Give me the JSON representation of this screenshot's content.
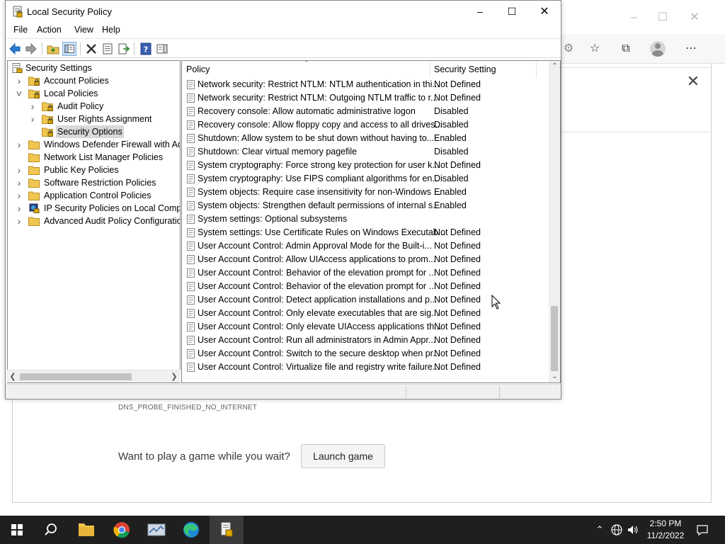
{
  "edge": {
    "error_code": "DNS_PROBE_FINISHED_NO_INTERNET",
    "game_prompt": "Want to play a game while you wait?",
    "launch_game_label": "Launch game"
  },
  "window": {
    "title": "Local Security Policy",
    "menu": [
      "File",
      "Action",
      "View",
      "Help"
    ]
  },
  "tree": {
    "items": [
      {
        "label": "Security Settings",
        "level": 0,
        "toggle": "",
        "icon": "security-settings-icon"
      },
      {
        "label": "Account Policies",
        "level": 1,
        "toggle": ">",
        "icon": "folder-lock-icon"
      },
      {
        "label": "Local Policies",
        "level": 1,
        "toggle": "v",
        "icon": "folder-lock-icon"
      },
      {
        "label": "Audit Policy",
        "level": 2,
        "toggle": ">",
        "icon": "folder-lock-icon"
      },
      {
        "label": "User Rights Assignment",
        "level": 2,
        "toggle": ">",
        "icon": "folder-lock-icon"
      },
      {
        "label": "Security Options",
        "level": 2,
        "toggle": "",
        "icon": "folder-lock-icon",
        "selected": true
      },
      {
        "label": "Windows Defender Firewall with Adva",
        "level": 1,
        "toggle": ">",
        "icon": "folder-icon"
      },
      {
        "label": "Network List Manager Policies",
        "level": 1,
        "toggle": "",
        "icon": "folder-icon"
      },
      {
        "label": "Public Key Policies",
        "level": 1,
        "toggle": ">",
        "icon": "folder-icon"
      },
      {
        "label": "Software Restriction Policies",
        "level": 1,
        "toggle": ">",
        "icon": "folder-icon"
      },
      {
        "label": "Application Control Policies",
        "level": 1,
        "toggle": ">",
        "icon": "folder-icon"
      },
      {
        "label": "IP Security Policies on Local Compute",
        "level": 1,
        "toggle": ">",
        "icon": "ip-security-icon"
      },
      {
        "label": "Advanced Audit Policy Configuration",
        "level": 1,
        "toggle": ">",
        "icon": "folder-icon"
      }
    ]
  },
  "list": {
    "col_policy": "Policy",
    "col_setting": "Security Setting",
    "rows": [
      {
        "policy": "Network security: Restrict NTLM: NTLM authentication in thi...",
        "setting": "Not Defined"
      },
      {
        "policy": "Network security: Restrict NTLM: Outgoing NTLM traffic to r...",
        "setting": "Not Defined"
      },
      {
        "policy": "Recovery console: Allow automatic administrative logon",
        "setting": "Disabled"
      },
      {
        "policy": "Recovery console: Allow floppy copy and access to all drives...",
        "setting": "Disabled"
      },
      {
        "policy": "Shutdown: Allow system to be shut down without having to...",
        "setting": "Enabled"
      },
      {
        "policy": "Shutdown: Clear virtual memory pagefile",
        "setting": "Disabled"
      },
      {
        "policy": "System cryptography: Force strong key protection for user k...",
        "setting": "Not Defined"
      },
      {
        "policy": "System cryptography: Use FIPS compliant algorithms for en...",
        "setting": "Disabled"
      },
      {
        "policy": "System objects: Require case insensitivity for non-Windows ...",
        "setting": "Enabled"
      },
      {
        "policy": "System objects: Strengthen default permissions of internal s...",
        "setting": "Enabled"
      },
      {
        "policy": "System settings: Optional subsystems",
        "setting": ""
      },
      {
        "policy": "System settings: Use Certificate Rules on Windows Executab...",
        "setting": "Not Defined"
      },
      {
        "policy": "User Account Control: Admin Approval Mode for the Built-i...",
        "setting": "Not Defined"
      },
      {
        "policy": "User Account Control: Allow UIAccess applications to prom...",
        "setting": "Not Defined"
      },
      {
        "policy": "User Account Control: Behavior of the elevation prompt for ...",
        "setting": "Not Defined"
      },
      {
        "policy": "User Account Control: Behavior of the elevation prompt for ...",
        "setting": "Not Defined"
      },
      {
        "policy": "User Account Control: Detect application installations and p...",
        "setting": "Not Defined"
      },
      {
        "policy": "User Account Control: Only elevate executables that are sig...",
        "setting": "Not Defined"
      },
      {
        "policy": "User Account Control: Only elevate UIAccess applications th...",
        "setting": "Not Defined"
      },
      {
        "policy": "User Account Control: Run all administrators in Admin Appr...",
        "setting": "Not Defined"
      },
      {
        "policy": "User Account Control: Switch to the secure desktop when pr...",
        "setting": "Not Defined"
      },
      {
        "policy": "User Account Control: Virtualize file and registry write failure...",
        "setting": "Not Defined"
      }
    ]
  },
  "taskbar": {
    "time": "2:50 PM",
    "date": "11/2/2022"
  }
}
